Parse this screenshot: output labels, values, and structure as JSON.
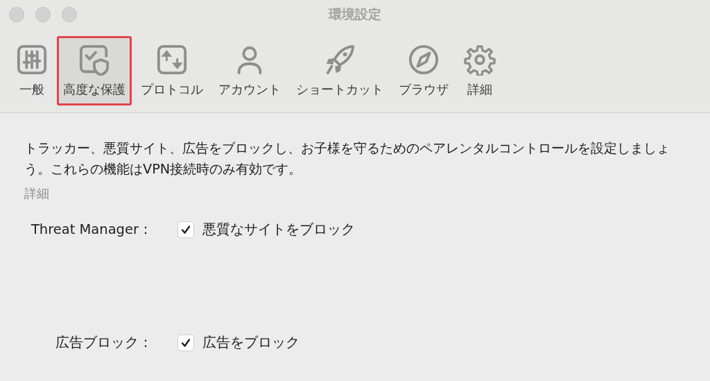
{
  "window": {
    "title": "環境設定"
  },
  "tabs": [
    {
      "label": "一般",
      "selected": false
    },
    {
      "label": "高度な保護",
      "selected": true
    },
    {
      "label": "プロトコル",
      "selected": false
    },
    {
      "label": "アカウント",
      "selected": false
    },
    {
      "label": "ショートカット",
      "selected": false
    },
    {
      "label": "ブラウザ",
      "selected": false
    },
    {
      "label": "詳細",
      "selected": false
    }
  ],
  "description": "トラッカー、悪質サイト、広告をブロックし、お子様を守るためのペアレンタルコントロールを設定しましょう。これらの機能はVPN接続時のみ有効です。",
  "section_heading": "詳細",
  "settings": [
    {
      "label": "Threat Manager：",
      "option": "悪質なサイトをブロック",
      "checked": true
    },
    {
      "label": "広告ブロック：",
      "option": "広告をブロック",
      "checked": true
    }
  ]
}
